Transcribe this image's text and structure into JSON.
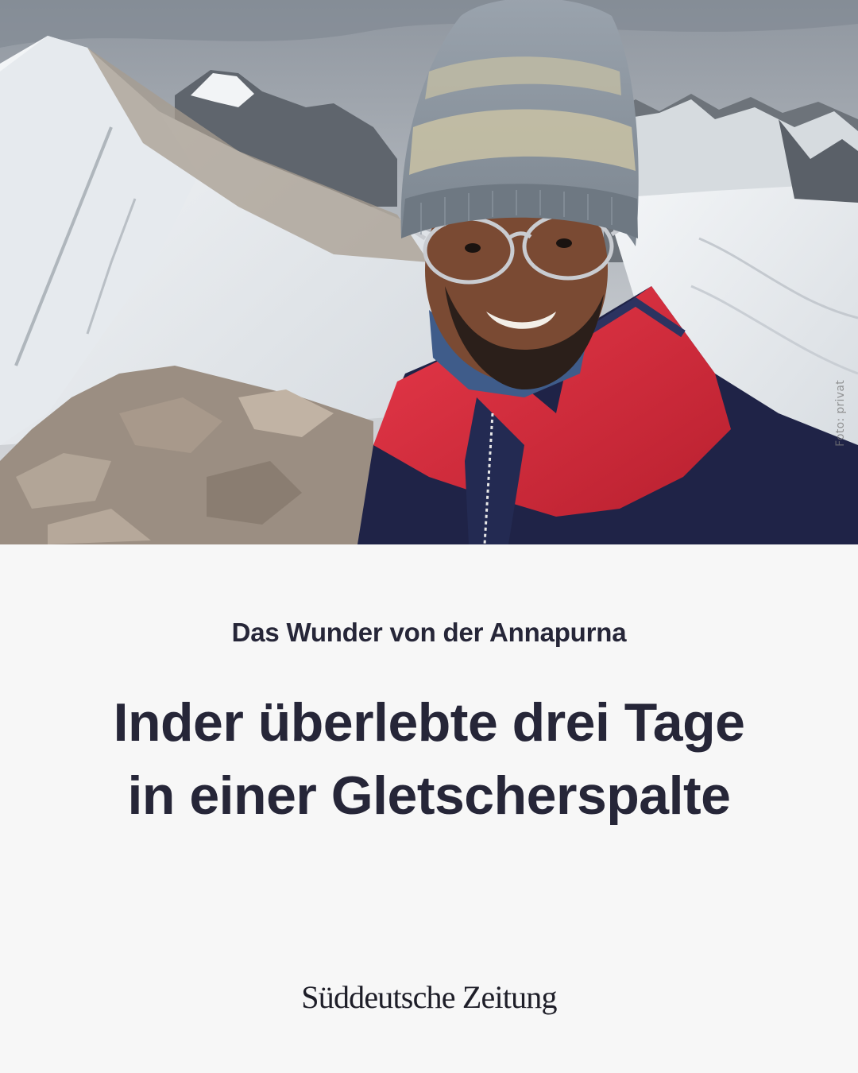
{
  "photo": {
    "description_icon": "portrait-photo",
    "credit": "Foto: privat"
  },
  "article": {
    "kicker": "Das Wunder von der Annapurna",
    "headline": "Inder überlebte drei Tage in einer Gletscherspalte"
  },
  "brand": {
    "name": "Süddeutsche Zeitung"
  },
  "colors": {
    "background": "#f7f7f7",
    "text": "#262638"
  }
}
